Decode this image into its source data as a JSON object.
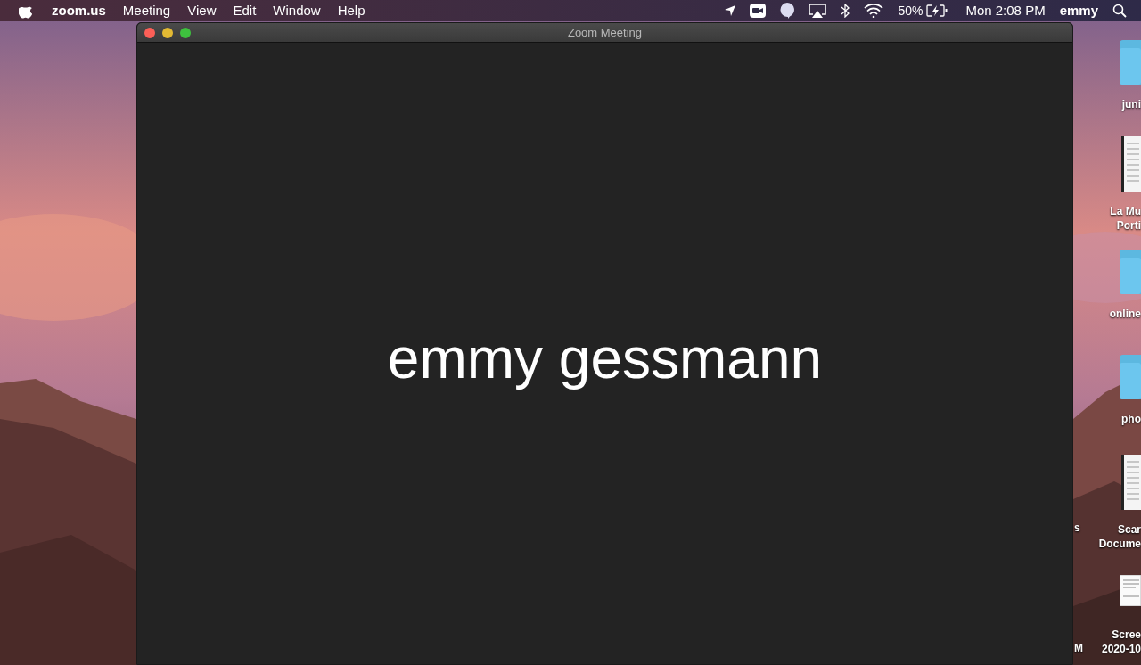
{
  "menu_bar": {
    "app_name": "zoom.us",
    "menus": [
      "Meeting",
      "View",
      "Edit",
      "Window",
      "Help"
    ],
    "battery_percent": "50%",
    "clock": "Mon 2:08 PM",
    "user": "emmy"
  },
  "window": {
    "title": "Zoom Meeting",
    "participant_name": "emmy gessmann"
  },
  "desktop_icons": [
    {
      "kind": "folder",
      "label_lines": [
        "juni"
      ]
    },
    {
      "kind": "document",
      "label_lines": [
        "La Mu",
        "Porti"
      ]
    },
    {
      "kind": "folder",
      "label_lines": [
        "online"
      ]
    },
    {
      "kind": "folder",
      "label_lines": [
        "pho"
      ]
    },
    {
      "kind": "document",
      "label_lines": [
        "Scar",
        "Docume"
      ]
    },
    {
      "kind": "screenshot",
      "label_lines": [
        "Scree",
        "2020-10"
      ]
    }
  ],
  "hidden_desktop_labels": [
    "s",
    "M"
  ]
}
